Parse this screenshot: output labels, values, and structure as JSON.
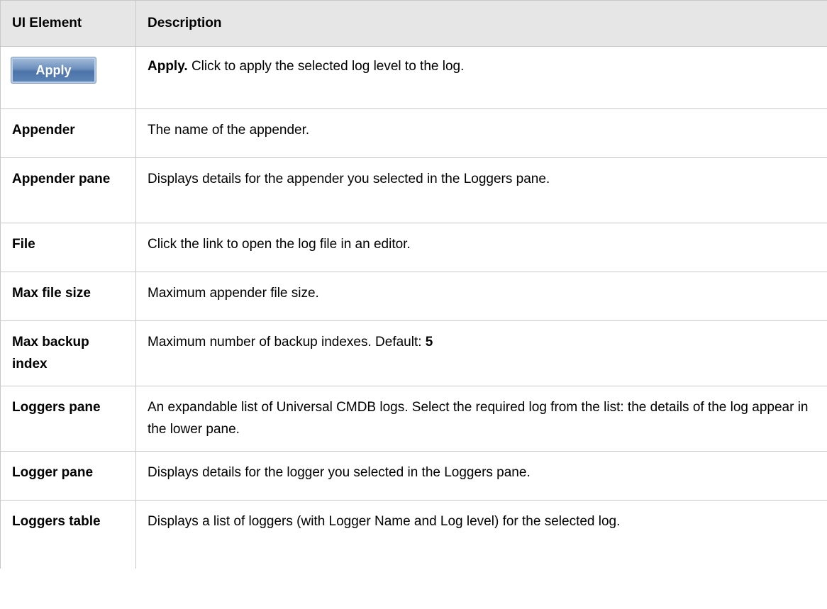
{
  "header": {
    "col_ui_element": "UI Element",
    "col_description": "Description"
  },
  "apply_button": {
    "label": "Apply"
  },
  "rows": [
    {
      "description_lead": "Apply.",
      "description": "Click to apply the selected log level to the log."
    },
    {
      "element": "Appender",
      "description": "The name of the appender."
    },
    {
      "element": "Appender pane",
      "description": "Displays details for the appender you selected in the Loggers pane."
    },
    {
      "element": "File",
      "description": "Click the link to open the log file in an editor."
    },
    {
      "element": "Max file size",
      "description": "Maximum appender file size."
    },
    {
      "element": "Max backup index",
      "description": "Maximum number of backup indexes. Default:",
      "default_value": "5"
    },
    {
      "element": "Loggers pane",
      "description": "An expandable list of Universal CMDB logs. Select the required log from the list: the details of the log appear in the lower pane."
    },
    {
      "element": "Logger pane",
      "description": "Displays details for the logger you selected in the Loggers pane."
    },
    {
      "element": "Loggers table",
      "description": "Displays a list of loggers (with Logger Name and Log level) for the selected log."
    }
  ]
}
